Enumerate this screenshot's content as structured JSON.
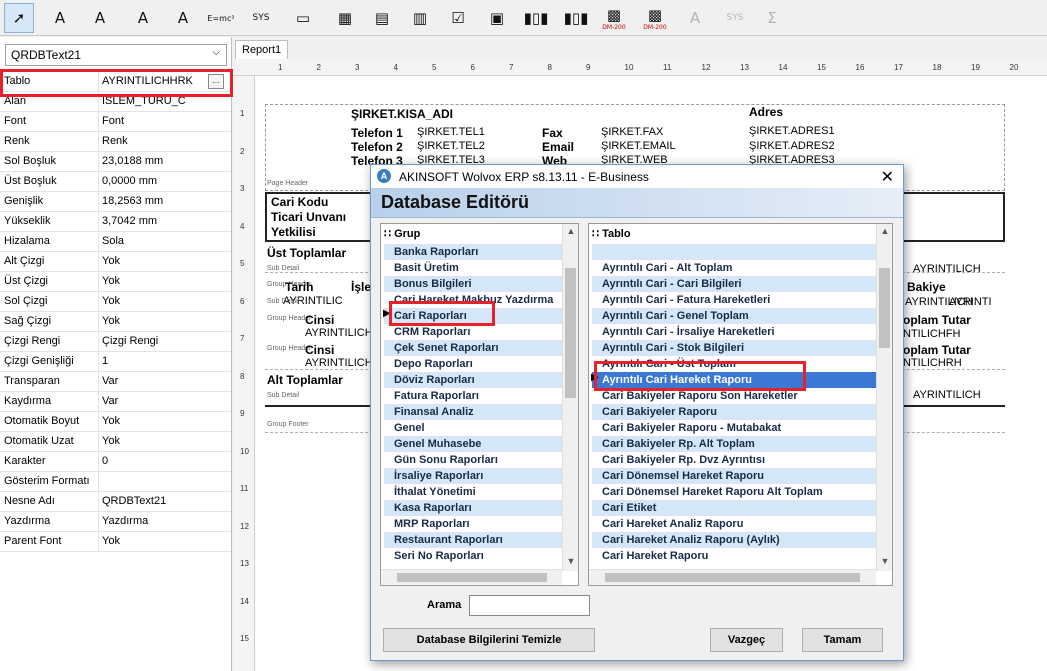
{
  "toolbar": {
    "items": [
      {
        "icon": "pointer-icon",
        "glyph": "➚"
      },
      {
        "icon": "text-icon",
        "glyph": "A"
      },
      {
        "icon": "db-text-icon",
        "glyph": "A"
      },
      {
        "icon": "memo-icon",
        "glyph": "A"
      },
      {
        "icon": "db-memo-icon",
        "glyph": "A"
      },
      {
        "icon": "formula-icon",
        "glyph": "E=mc²"
      },
      {
        "icon": "sys-icon",
        "glyph": "SYS"
      },
      {
        "icon": "shape-icon",
        "glyph": "▭"
      },
      {
        "icon": "image-icon",
        "glyph": "▦"
      },
      {
        "icon": "db-image-icon",
        "glyph": "▤"
      },
      {
        "icon": "richtext-icon",
        "glyph": "▥"
      },
      {
        "icon": "checkbox-icon",
        "glyph": "☑"
      },
      {
        "icon": "subreport-icon",
        "glyph": "▣"
      },
      {
        "icon": "barcode-icon",
        "glyph": "▮▯▮"
      },
      {
        "icon": "db-barcode-icon",
        "glyph": "▮▯▮"
      },
      {
        "icon": "datamatrix-icon",
        "glyph": "▩",
        "sub": "DM-200"
      },
      {
        "icon": "db-datamatrix-icon",
        "glyph": "▩",
        "sub": "DM-200"
      },
      {
        "icon": "text-disabled-icon",
        "glyph": "A"
      },
      {
        "icon": "sys-disabled-icon",
        "glyph": "SYS"
      },
      {
        "icon": "sum-disabled-icon",
        "glyph": "Σ"
      }
    ]
  },
  "object_selector": {
    "value": "QRDBText21"
  },
  "properties": [
    {
      "name": "Tablo",
      "value": "AYRINTILICHHRK"
    },
    {
      "name": "Alan",
      "value": "ISLEM_TURU_C"
    },
    {
      "name": "Font",
      "value": "Font"
    },
    {
      "name": "Renk",
      "value": "Renk"
    },
    {
      "name": "Sol Boşluk",
      "value": "23,0188 mm"
    },
    {
      "name": "Üst Boşluk",
      "value": "0,0000 mm"
    },
    {
      "name": "Genişlik",
      "value": "18,2563 mm"
    },
    {
      "name": "Yükseklik",
      "value": "3,7042 mm"
    },
    {
      "name": "Hizalama",
      "value": "Sola"
    },
    {
      "name": "Alt Çizgi",
      "value": "Yok"
    },
    {
      "name": "Üst Çizgi",
      "value": "Yok"
    },
    {
      "name": "Sol Çizgi",
      "value": "Yok"
    },
    {
      "name": "Sağ Çizgi",
      "value": "Yok"
    },
    {
      "name": "Çizgi Rengi",
      "value": "Çizgi Rengi"
    },
    {
      "name": "Çizgi Genişliği",
      "value": "1"
    },
    {
      "name": "Transparan",
      "value": "Var"
    },
    {
      "name": "Kaydırma",
      "value": "Var"
    },
    {
      "name": "Otomatik Boyut",
      "value": "Yok"
    },
    {
      "name": "Otomatik Uzat",
      "value": "Yok"
    },
    {
      "name": "Karakter",
      "value": "0"
    },
    {
      "name": "Gösterim Formatı",
      "value": ""
    },
    {
      "name": "Nesne Adı",
      "value": "QRDBText21"
    },
    {
      "name": "Yazdırma",
      "value": "Yazdırma"
    },
    {
      "name": "Parent Font",
      "value": "Yok"
    }
  ],
  "report_tab": "Report1",
  "ruler": {
    "h": [
      "1",
      "2",
      "3",
      "4",
      "5",
      "6",
      "7",
      "8",
      "9",
      "10",
      "11",
      "12",
      "13",
      "14",
      "15",
      "16",
      "17",
      "18",
      "19",
      "20"
    ],
    "v": [
      "1",
      "2",
      "3",
      "4",
      "5",
      "6",
      "7",
      "8",
      "9",
      "10",
      "11",
      "12",
      "13",
      "14",
      "15"
    ]
  },
  "report": {
    "company_short": "ŞIRKET.KISA_ADI",
    "tel1_lbl": "Telefon 1",
    "tel1": "ŞIRKET.TEL1",
    "tel2_lbl": "Telefon 2",
    "tel2": "ŞIRKET.TEL2",
    "tel3_lbl": "Telefon 3",
    "tel3": "ŞIRKET.TEL3",
    "fax_lbl": "Fax",
    "fax": "ŞIRKET.FAX",
    "email_lbl": "Email",
    "email": "ŞIRKET.EMAIL",
    "web_lbl": "Web",
    "web": "ŞIRKET.WEB",
    "adres_lbl": "Adres",
    "adres1": "ŞIRKET.ADRES1",
    "adres2": "ŞIRKET.ADRES2",
    "adres3": "ŞIRKET.ADRES3",
    "page_header": "Page Header",
    "cari_kodu": "Cari Kodu",
    "ticari_unvani": "Ticari Unvanı",
    "yetkilisi": "Yetkilisi",
    "ust_toplamlar": "Üst Toplamlar",
    "sub_detail": "Sub Detail",
    "group_header": "Group Header",
    "group_footer": "Group Footer",
    "tarih": "Tarih",
    "islem": "İşle",
    "ayrintilic": "AYRINTILIC",
    "ayrintilich": "AYRINTILICH",
    "cinsi": "Cinsi",
    "alt_toplamlar": "Alt Toplamlar",
    "bakiye": "Bakiye",
    "toplam_tutar": "oplam Tutar",
    "ayrintilichfh": "NTILICHFH",
    "ayrintilichh": "INTILICHH",
    "ayrintilichrh": "NTILICHRH",
    "ayrintili_tr": "AYRINTI"
  },
  "dialog": {
    "title": "AKINSOFT Wolvox ERP s8.13.11 - E-Business",
    "header": "Database Editörü",
    "group_header": "Grup",
    "groups": [
      "Banka Raporları",
      "Basit Üretim",
      "Bonus Bilgileri",
      "Cari Hareket Makbuz Yazdırma",
      "Cari Raporları",
      "CRM Raporları",
      "Çek Senet Raporları",
      "Depo Raporları",
      "Döviz Raporları",
      "Fatura Raporları",
      "Finansal Analiz",
      "Genel",
      "Genel Muhasebe",
      "Gün Sonu Raporları",
      "İrsaliye Raporları",
      "İthalat Yönetimi",
      "Kasa Raporları",
      "MRP Raporları",
      "Restaurant Raporları",
      "Seri No Raporları"
    ],
    "table_header": "Tablo",
    "tables": [
      "",
      "Ayrıntılı Cari - Alt Toplam",
      "Ayrıntılı Cari - Cari Bilgileri",
      "Ayrıntılı Cari - Fatura Hareketleri",
      "Ayrıntılı Cari - Genel Toplam",
      "Ayrıntılı Cari - İrsaliye Hareketleri",
      "Ayrıntılı Cari - Stok Bilgileri",
      "Ayrıntılı Cari - Üst Toplam",
      "Ayrıntılı Cari Hareket Raporu",
      "Cari Bakiyeler Raporu Son Hareketler",
      "Cari Bakiyeler Raporu",
      "Cari Bakiyeler Raporu - Mutabakat",
      "Cari Bakiyeler Rp. Alt Toplam",
      "Cari Bakiyeler Rp. Dvz Ayrıntısı",
      "Cari Dönemsel Hareket Raporu",
      "Cari Dönemsel Hareket Raporu Alt Toplam",
      "Cari Etiket",
      "Cari Hareket Analiz Raporu",
      "Cari Hareket Analiz Raporu (Aylık)",
      "Cari Hareket Raporu"
    ],
    "search_label": "Arama",
    "search_value": "",
    "clear_button": "Database Bilgilerini Temizle",
    "cancel_button": "Vazgeç",
    "ok_button": "Tamam"
  },
  "colors": {
    "highlight": "#3b78d6",
    "alt_row": "#d5e6f6",
    "red_box": "#e8202a"
  }
}
